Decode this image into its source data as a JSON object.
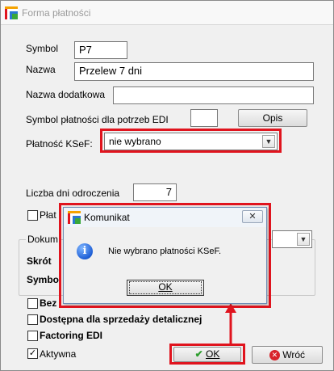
{
  "window": {
    "title": "Forma płatności"
  },
  "form": {
    "symbol_label": "Symbol",
    "symbol_value": "P7",
    "nazwa_label": "Nazwa",
    "nazwa_value": "Przelew 7 dni",
    "nazwa_dodatkowa_label": "Nazwa dodatkowa",
    "nazwa_dodatkowa_value": "",
    "edi_label": "Symbol płatności dla potrzeb EDI",
    "edi_value": "",
    "opis_button": "Opis",
    "ksef_label": "Płatność KSeF:",
    "ksef_selected": "nie wybrano",
    "liczba_dni_label": "Liczba dni odroczenia",
    "liczba_dni_value": "7",
    "plat_checkbox_label": "Płat",
    "dokum_label": "Dokum",
    "skrot_label": "Skrót",
    "symbo_label": "Symbo",
    "bez_label": "Bez",
    "dostepna_label": "Dostępna dla sprzedaży detalicznej",
    "factoring_label": "Factoring EDI",
    "aktywna_label": "Aktywna",
    "aktywna_checked": true
  },
  "buttons": {
    "ok": "OK",
    "wroc": "Wróć"
  },
  "dialog": {
    "title": "Komunikat",
    "message": "Nie wybrano płatności KSeF.",
    "ok": "OK"
  },
  "colors": {
    "highlight": "#e0141e",
    "window_bg": "#f0f0f0"
  }
}
